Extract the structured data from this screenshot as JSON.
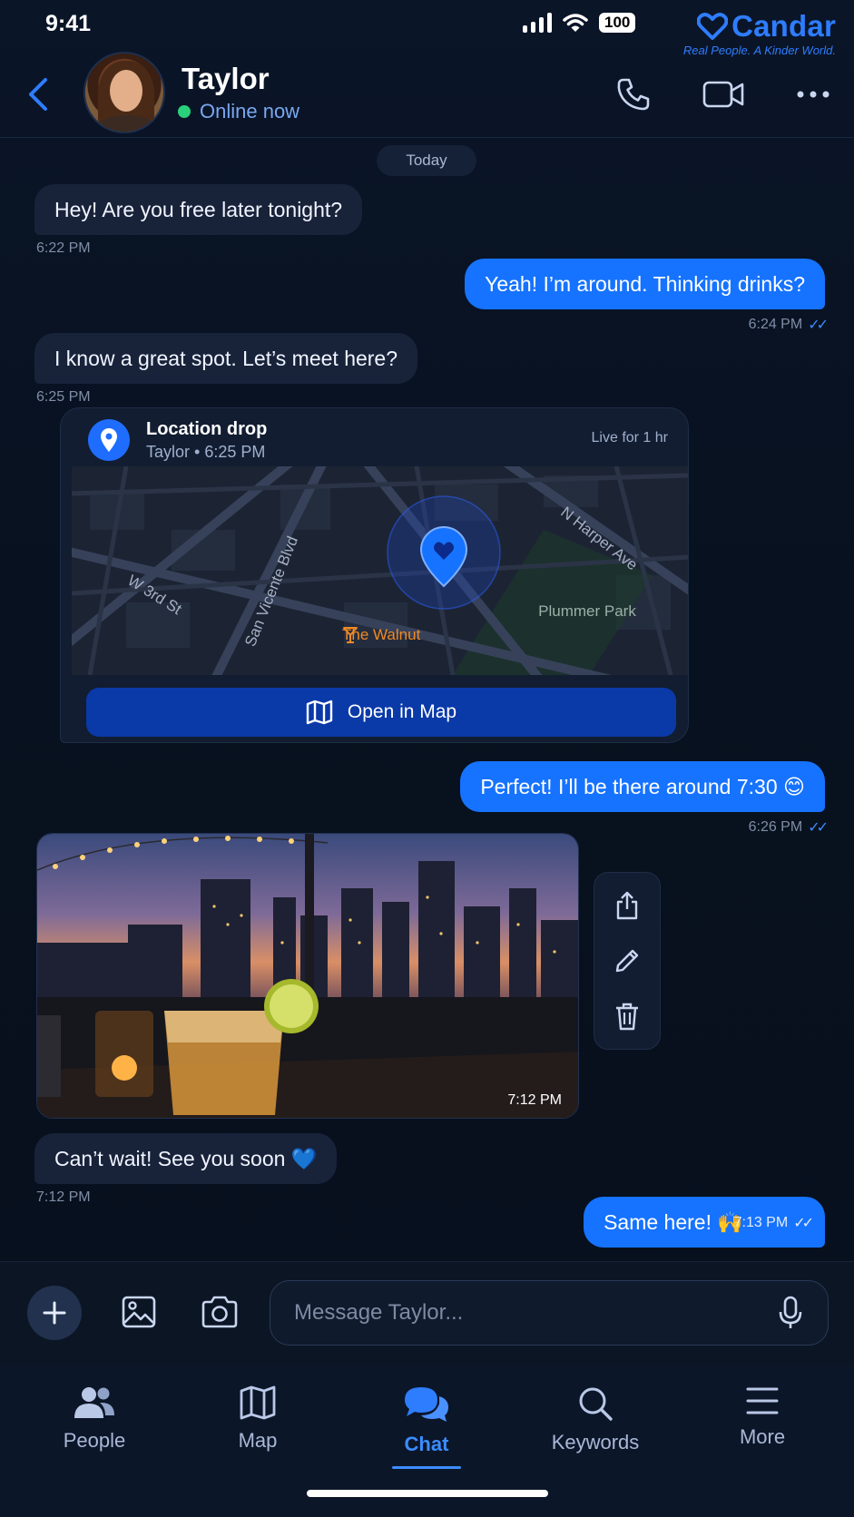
{
  "status": {
    "time": "9:41",
    "battery": "100"
  },
  "brand": {
    "name": "Candar",
    "tagline": "Real People. A Kinder World."
  },
  "header": {
    "contact_name": "Taylor",
    "contact_status": "Online now"
  },
  "chat": {
    "day_label": "Today",
    "messages": [
      {
        "text": "Hey! Are you free later tonight?",
        "time": "6:22 PM"
      },
      {
        "text": "Yeah! I’m around. Thinking drinks?",
        "time": "6:24 PM"
      },
      {
        "text": "I know a great spot. Let’s meet here?",
        "time": "6:25 PM"
      },
      {
        "text": "Perfect! I’ll be there around 7:30 😊",
        "time": "6:26 PM"
      },
      {
        "text": "Can’t wait! See you soon 💙",
        "time": "7:12 PM"
      },
      {
        "text": "Same here! 🙌",
        "time": "7:13 PM"
      }
    ],
    "location": {
      "title": "Location drop",
      "subtitle": "Taylor • 6:25 PM",
      "live": "Live for 1 hr",
      "streets": [
        "W 3rd St",
        "San Vicente Blvd",
        "N Harper Ave"
      ],
      "park": "Plummer Park",
      "venue": "The Walnut",
      "open_label": "Open in Map"
    },
    "photo_time": "7:12 PM"
  },
  "composer": {
    "placeholder": "Message Taylor..."
  },
  "tabs": [
    {
      "label": "People",
      "icon": "people-icon"
    },
    {
      "label": "Map",
      "icon": "map-icon"
    },
    {
      "label": "Chat",
      "icon": "chat-icon"
    },
    {
      "label": "Keywords",
      "icon": "search-icon"
    },
    {
      "label": "More",
      "icon": "menu-icon"
    }
  ],
  "colors": {
    "accent": "#1673ff",
    "background": "#08111f",
    "incoming_bubble": "#18233a",
    "online": "#29d17a",
    "venue": "#f08a24"
  }
}
